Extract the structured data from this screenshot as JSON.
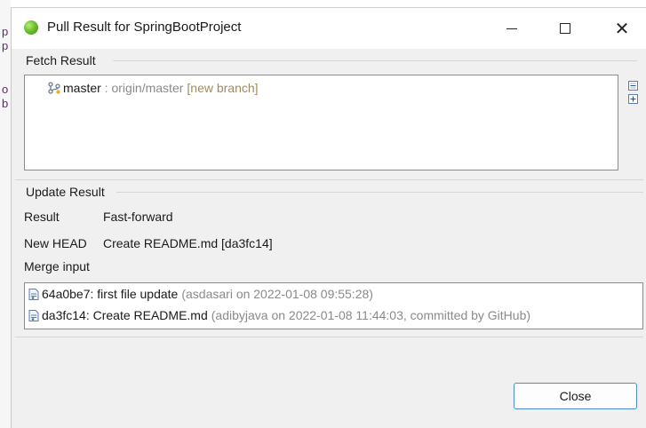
{
  "background": {
    "chars": [
      "p",
      "p",
      "o",
      "b"
    ]
  },
  "window": {
    "title": "Pull Result for SpringBootProject",
    "minimize_glyph": "—",
    "close_glyph": "✕"
  },
  "fetch": {
    "label": "Fetch Result",
    "rows": [
      {
        "branch": "master",
        "separator": " : ",
        "remote": "origin/master",
        "status": "[new branch]"
      }
    ]
  },
  "update": {
    "label": "Update Result",
    "result_key": "Result",
    "result_value": "Fast-forward",
    "newhead_key": "New HEAD",
    "newhead_value": "Create README.md [da3fc14]",
    "merge_label": "Merge input",
    "commits": [
      {
        "message": "64a0be7: first file update",
        "meta": "(asdasari on 2022-01-08 09:55:28)"
      },
      {
        "message": "da3fc14: Create README.md",
        "meta": "(adibyjava on 2022-01-08 11:44:03, committed by GitHub)"
      }
    ]
  },
  "buttons": {
    "close": "Close"
  },
  "colors": {
    "accent": "#4a8bd6",
    "muted": "#8a8a8a",
    "branch_status": "#a38a5a"
  }
}
